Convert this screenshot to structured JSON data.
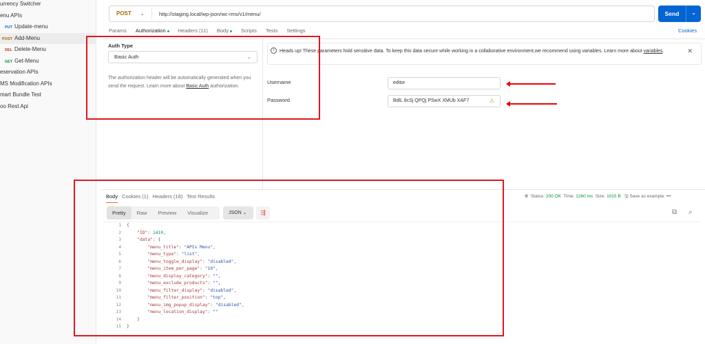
{
  "sidebar": {
    "items": [
      {
        "label": "urrency Switcher",
        "method": "",
        "indent": 0
      },
      {
        "label": "enu APIs",
        "method": "",
        "indent": 0
      },
      {
        "label": "Update-menu",
        "method": "PUT",
        "color": "#0b62d6",
        "indent": 1
      },
      {
        "label": "Add-Menu",
        "method": "POST",
        "color": "#a86a00",
        "indent": 1,
        "active": true
      },
      {
        "label": "Delete-Menu",
        "method": "DEL",
        "color": "#c0392b",
        "indent": 1
      },
      {
        "label": "Get-Menu",
        "method": "GET",
        "color": "#0a8f3e",
        "indent": 1
      },
      {
        "label": "eservation APIs",
        "method": "",
        "indent": 0
      },
      {
        "label": "MS Modification APIs",
        "method": "",
        "indent": 0
      },
      {
        "label": "mart Bundle Test",
        "method": "",
        "indent": 0
      },
      {
        "label": "oo Rest Api",
        "method": "",
        "indent": 0
      }
    ]
  },
  "request": {
    "method": "POST",
    "url": "http://staging.local/wp-json/wc-rms/v1/menu/",
    "send_label": "Send",
    "tabs": [
      {
        "label": "Params"
      },
      {
        "label": "Authorization",
        "dot": true,
        "active": true
      },
      {
        "label": "Headers (11)"
      },
      {
        "label": "Body",
        "dot": true
      },
      {
        "label": "Scripts"
      },
      {
        "label": "Tests"
      },
      {
        "label": "Settings"
      }
    ],
    "cookies_label": "Cookies"
  },
  "auth": {
    "type_label": "Auth Type",
    "type_value": "Basic Auth",
    "desc_before": "The authorization header will be automatically generated when you send the request. Learn more about ",
    "desc_link": "Basic Auth",
    "desc_after": " authorization.",
    "alert_text": "Heads up! These parameters hold sensitive data. To keep this data secure while working in a collaborative environment,we recommend using variables. Learn more about ",
    "alert_link": "variables",
    "alert_end": ".",
    "username_label": "Username",
    "username_value": "editor",
    "password_label": "Password",
    "password_value": "BdlL 8cSj QPQj PSwX XMUb XAF7"
  },
  "response": {
    "tabs": [
      {
        "label": "Body",
        "active": true
      },
      {
        "label": "Cookies (1)"
      },
      {
        "label": "Headers (18)"
      },
      {
        "label": "Test Results"
      }
    ],
    "status_label": "Status:",
    "status_value": "200 OK",
    "time_label": "Time:",
    "time_value": "1260 ms",
    "size_label": "Size:",
    "size_value": "1015 B",
    "save_label": "Save as example",
    "views": [
      {
        "label": "Pretty",
        "active": true
      },
      {
        "label": "Raw"
      },
      {
        "label": "Preview"
      },
      {
        "label": "Visualize"
      }
    ],
    "format": "JSON",
    "code": [
      [
        [
          "p",
          "{"
        ]
      ],
      [
        [
          "p",
          "    "
        ],
        [
          "k",
          "\"ID\""
        ],
        [
          "p",
          ": "
        ],
        [
          "n",
          "1410"
        ],
        [
          "p",
          ","
        ]
      ],
      [
        [
          "p",
          "    "
        ],
        [
          "k",
          "\"data\""
        ],
        [
          "p",
          ": {"
        ]
      ],
      [
        [
          "p",
          "        "
        ],
        [
          "k",
          "\"menu_title\""
        ],
        [
          "p",
          ": "
        ],
        [
          "s",
          "\"APIs Menu\""
        ],
        [
          "p",
          ","
        ]
      ],
      [
        [
          "p",
          "        "
        ],
        [
          "k",
          "\"menu_type\""
        ],
        [
          "p",
          ": "
        ],
        [
          "s",
          "\"list\""
        ],
        [
          "p",
          ","
        ]
      ],
      [
        [
          "p",
          "        "
        ],
        [
          "k",
          "\"menu_toggle_display\""
        ],
        [
          "p",
          ": "
        ],
        [
          "s",
          "\"disabled\""
        ],
        [
          "p",
          ","
        ]
      ],
      [
        [
          "p",
          "        "
        ],
        [
          "k",
          "\"menu_item_per_page\""
        ],
        [
          "p",
          ": "
        ],
        [
          "s",
          "\"10\""
        ],
        [
          "p",
          ","
        ]
      ],
      [
        [
          "p",
          "        "
        ],
        [
          "k",
          "\"menu_display_category\""
        ],
        [
          "p",
          ": "
        ],
        [
          "s",
          "\"\""
        ],
        [
          "p",
          ","
        ]
      ],
      [
        [
          "p",
          "        "
        ],
        [
          "k",
          "\"menu_exclude_products\""
        ],
        [
          "p",
          ": "
        ],
        [
          "s",
          "\"\""
        ],
        [
          "p",
          ","
        ]
      ],
      [
        [
          "p",
          "        "
        ],
        [
          "k",
          "\"menu_filter_display\""
        ],
        [
          "p",
          ": "
        ],
        [
          "s",
          "\"disabled\""
        ],
        [
          "p",
          ","
        ]
      ],
      [
        [
          "p",
          "        "
        ],
        [
          "k",
          "\"menu_filter_position\""
        ],
        [
          "p",
          ": "
        ],
        [
          "s",
          "\"top\""
        ],
        [
          "p",
          ","
        ]
      ],
      [
        [
          "p",
          "        "
        ],
        [
          "k",
          "\"menu_img_popup_display\""
        ],
        [
          "p",
          ": "
        ],
        [
          "s",
          "\"disabled\""
        ],
        [
          "p",
          ","
        ]
      ],
      [
        [
          "p",
          "        "
        ],
        [
          "k",
          "\"menu_location_display\""
        ],
        [
          "p",
          ": "
        ],
        [
          "s",
          "\"\""
        ]
      ],
      [
        [
          "p",
          "    }"
        ]
      ],
      [
        [
          "p",
          "}"
        ]
      ]
    ]
  }
}
